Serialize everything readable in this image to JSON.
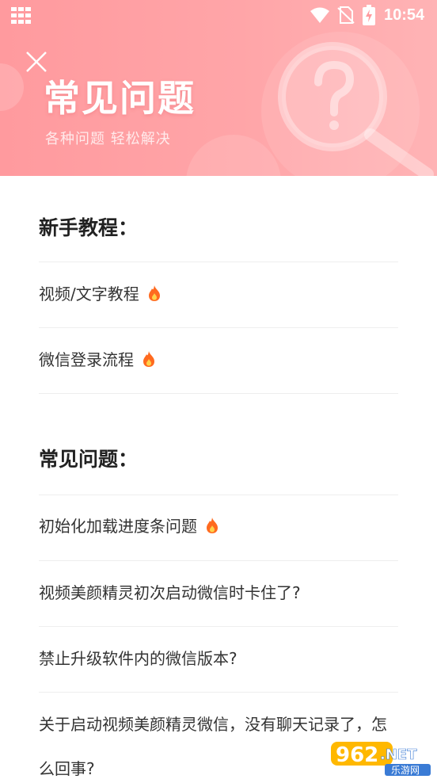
{
  "status_bar": {
    "time": "10:54",
    "left_icon": "app-grid-icon",
    "right_icons": [
      "wifi-icon",
      "no-sim-icon",
      "battery-charging-icon"
    ]
  },
  "header": {
    "title": "常见问题",
    "subtitle": "各种问题 轻松解决",
    "close_icon": "close-icon",
    "decoration_icon": "question-magnifier-icon",
    "gradient_colors": [
      "#ff9a9e",
      "#ffb3b5"
    ]
  },
  "sections": [
    {
      "title": "新手教程：",
      "items": [
        {
          "label": "视频/文字教程",
          "hot": true
        },
        {
          "label": "微信登录流程",
          "hot": true
        }
      ]
    },
    {
      "title": "常见问题：",
      "items": [
        {
          "label": "初始化加载进度条问题",
          "hot": true
        },
        {
          "label": "视频美颜精灵初次启动微信时卡住了?",
          "hot": false
        },
        {
          "label": "禁止升级软件内的微信版本?",
          "hot": false
        },
        {
          "label": "关于启动视频美颜精灵微信，没有聊天记录了，怎么回事?",
          "hot": false
        }
      ]
    }
  ],
  "watermark": {
    "number": "962",
    "tld": ".NET",
    "site": "乐游网"
  },
  "colors": {
    "hot_icon": "#ff6a1f",
    "header_text": "#ffffff"
  }
}
